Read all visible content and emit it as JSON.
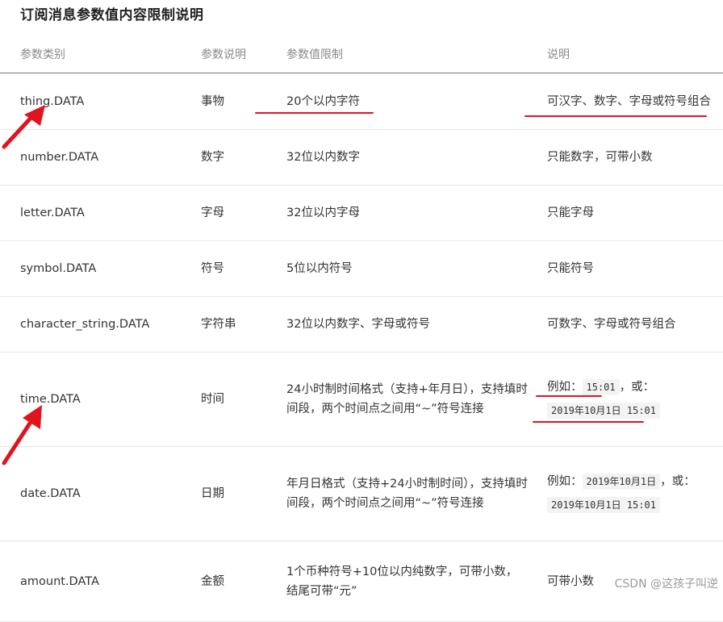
{
  "title": "订阅消息参数值内容限制说明",
  "headers": [
    "参数类别",
    "参数说明",
    "参数值限制",
    "说明"
  ],
  "rows": [
    {
      "type": "thing.DATA",
      "desc": "事物",
      "limit": "20个以内字符",
      "note": "可汉字、数字、字母或符号组合"
    },
    {
      "type": "number.DATA",
      "desc": "数字",
      "limit": "32位以内数字",
      "note": "只能数字，可带小数"
    },
    {
      "type": "letter.DATA",
      "desc": "字母",
      "limit": "32位以内字母",
      "note": "只能字母"
    },
    {
      "type": "symbol.DATA",
      "desc": "符号",
      "limit": "5位以内符号",
      "note": "只能符号"
    },
    {
      "type": "character_string.DATA",
      "desc": "字符串",
      "limit": "32位以内数字、字母或符号",
      "note": "可数字、字母或符号组合"
    },
    {
      "type": "time.DATA",
      "desc": "时间",
      "limit": "24小时制时间格式（支持+年月日），支持填时间段，两个时间点之间用“~”符号连接",
      "note_prefix": "例如：",
      "note_code1": "15:01",
      "note_mid": "，或：",
      "note_code2": "2019年10月1日 15:01"
    },
    {
      "type": "date.DATA",
      "desc": "日期",
      "limit": "年月日格式（支持+24小时制时间），支持填时间段，两个时间点之间用“~”符号连接",
      "note_prefix": "例如：",
      "note_code1": "2019年10月1日",
      "note_mid": "，或：",
      "note_code2": "2019年10月1日 15:01"
    },
    {
      "type": "amount.DATA",
      "desc": "金额",
      "limit": "1个币种符号+10位以内纯数字，可带小数，结尾可带“元”",
      "note": "可带小数"
    }
  ],
  "watermark": "CSDN @这孩子叫逆",
  "colors": {
    "annotation": "#e0141e"
  }
}
